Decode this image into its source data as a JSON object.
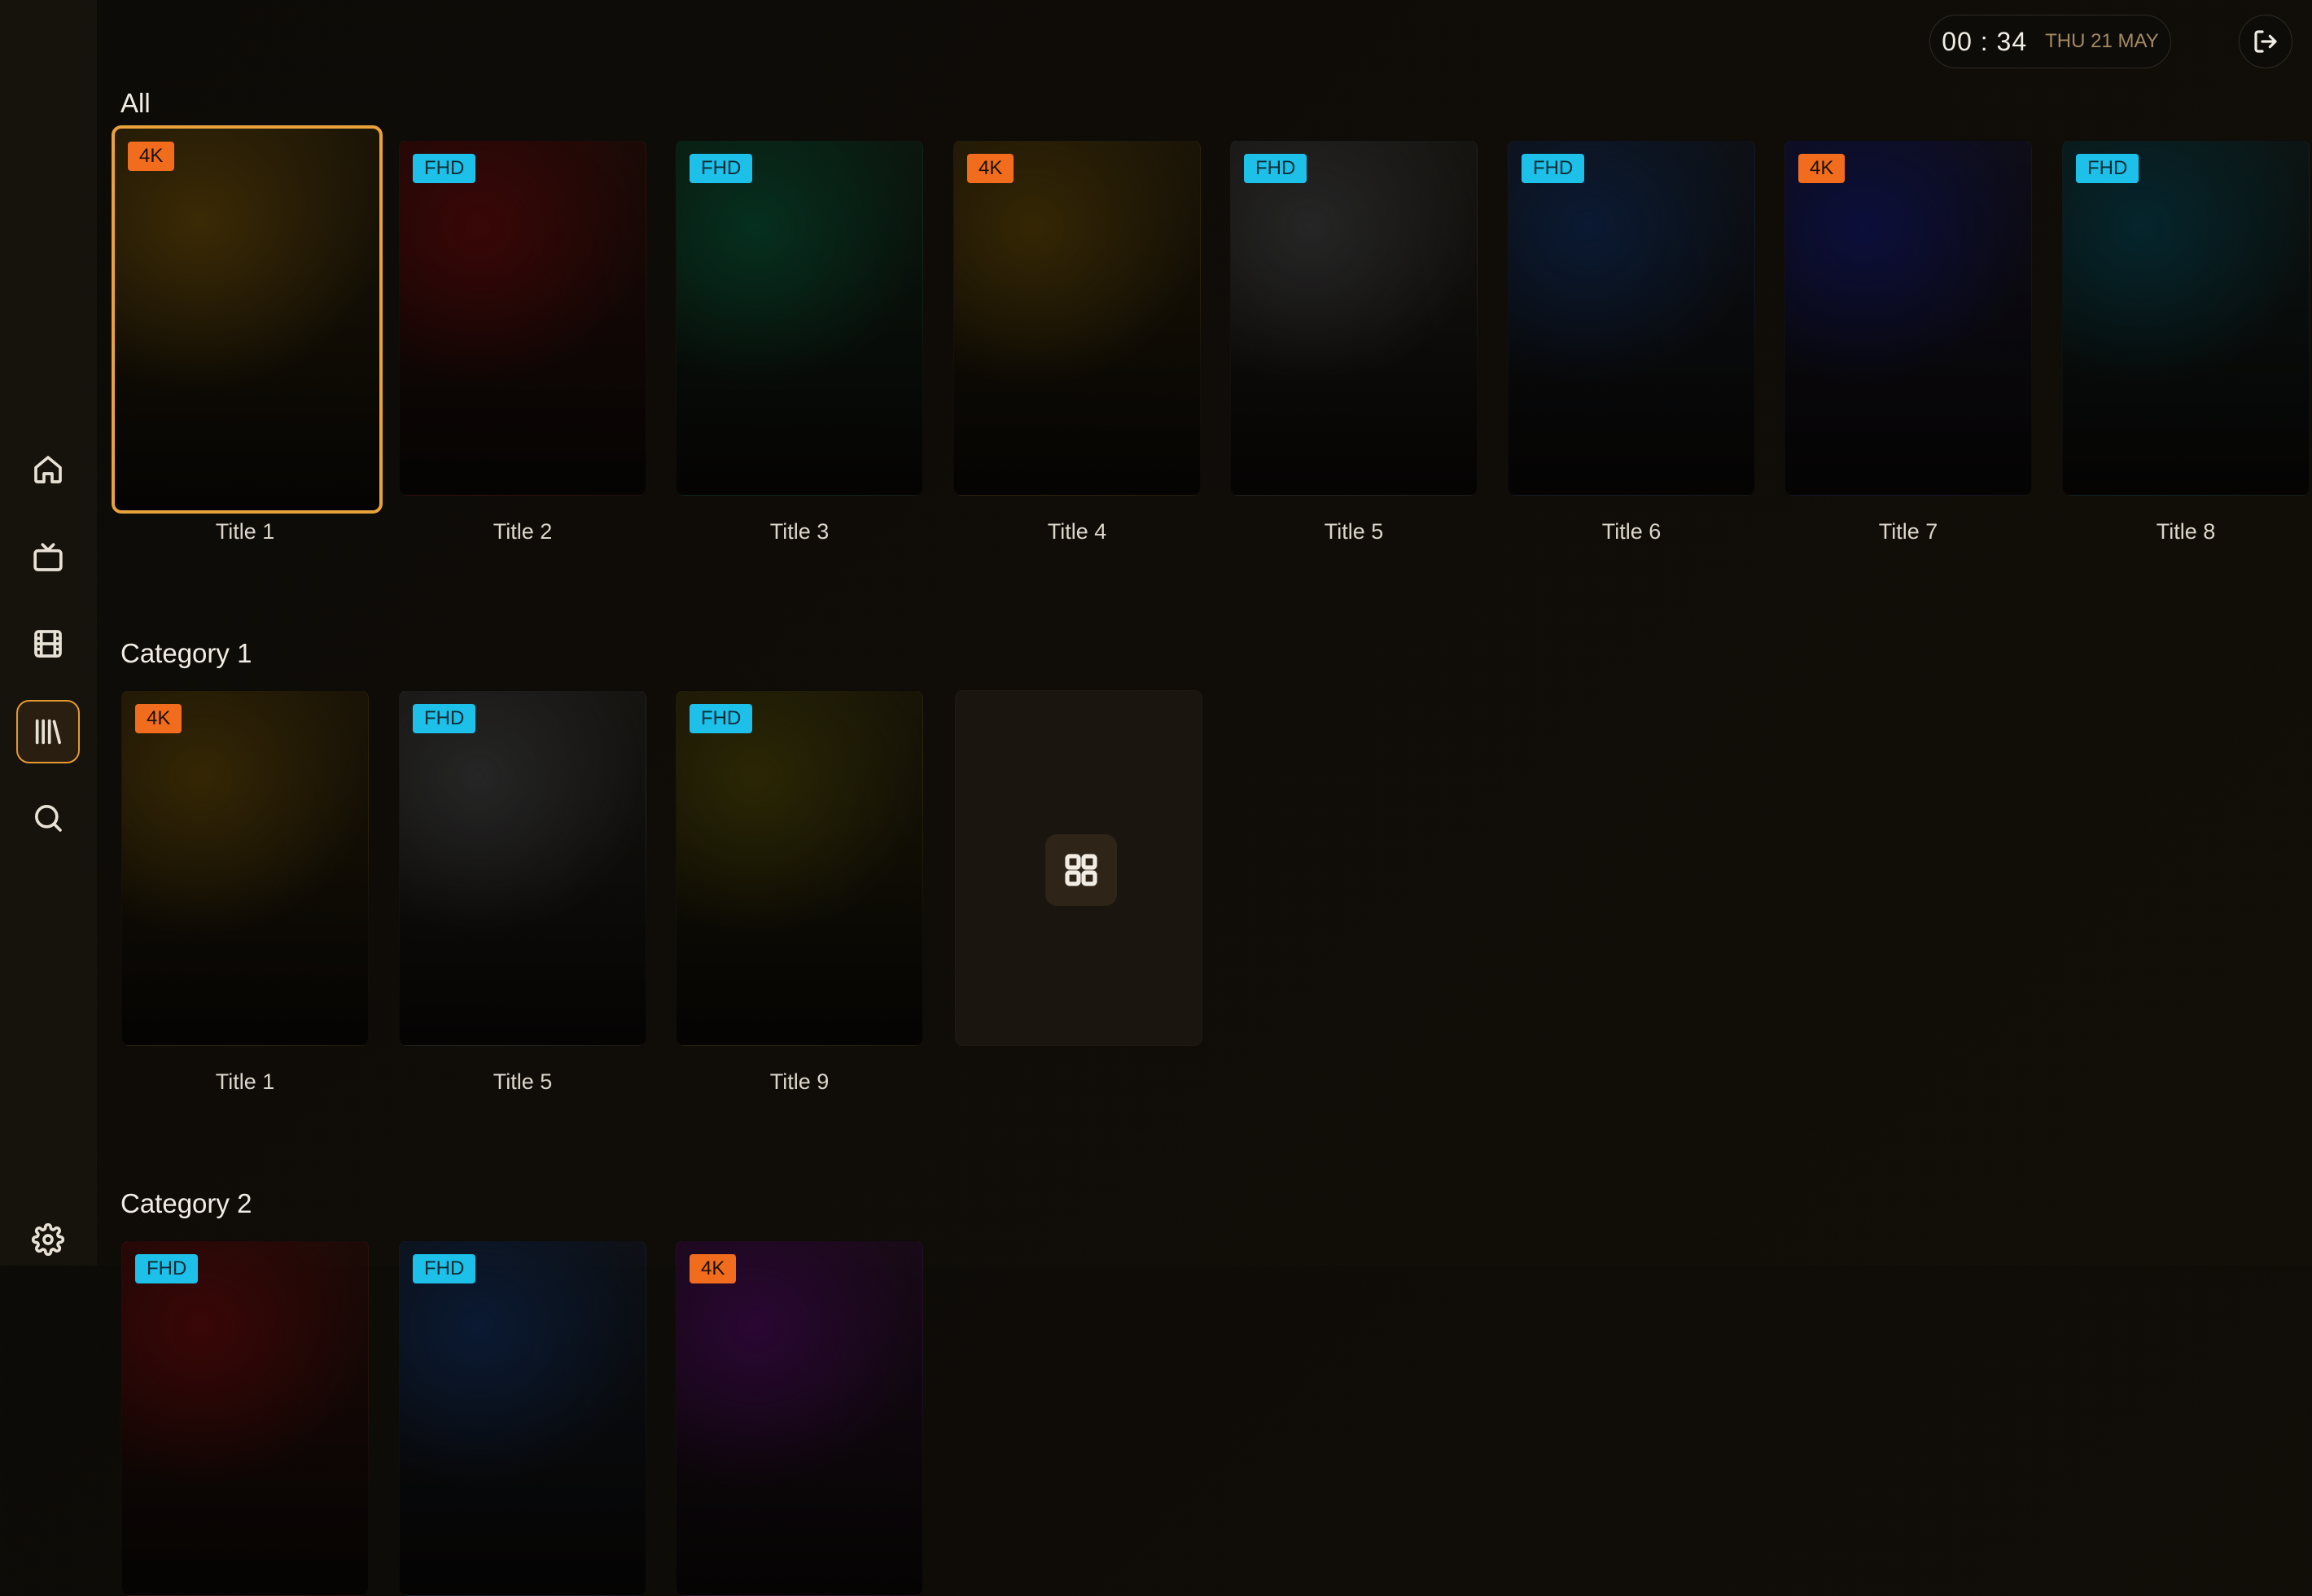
{
  "header": {
    "time": "00 : 34",
    "date": "THU 21 MAY"
  },
  "sidebar": {
    "items": [
      {
        "id": "home",
        "icon": "home-icon"
      },
      {
        "id": "tv",
        "icon": "tv-icon"
      },
      {
        "id": "movies",
        "icon": "film-icon"
      },
      {
        "id": "library",
        "icon": "library-icon",
        "active": true
      },
      {
        "id": "search",
        "icon": "search-icon"
      },
      {
        "id": "settings",
        "icon": "gear-icon"
      }
    ]
  },
  "sections": [
    {
      "title": "All",
      "items": [
        {
          "title": "Title 1",
          "badge": "4K"
        },
        {
          "title": "Title 2",
          "badge": "FHD"
        },
        {
          "title": "Title 3",
          "badge": "FHD"
        },
        {
          "title": "Title 4",
          "badge": "4K"
        },
        {
          "title": "Title 5",
          "badge": "FHD"
        },
        {
          "title": "Title 6",
          "badge": "FHD"
        },
        {
          "title": "Title 7",
          "badge": "4K"
        },
        {
          "title": "Title 8",
          "badge": "FHD"
        }
      ]
    },
    {
      "title": "Category 1",
      "items": [
        {
          "title": "Title 1",
          "badge": "4K"
        },
        {
          "title": "Title 5",
          "badge": "FHD"
        },
        {
          "title": "Title 9",
          "badge": "FHD"
        }
      ]
    },
    {
      "title": "Category 2",
      "items": [
        {
          "badge": "FHD"
        },
        {
          "badge": "FHD"
        },
        {
          "badge": "4K"
        }
      ]
    }
  ],
  "colors": {
    "accent": "#e9a33a",
    "badge_4k": "#f26c1e",
    "badge_fhd": "#1dc0e8"
  }
}
